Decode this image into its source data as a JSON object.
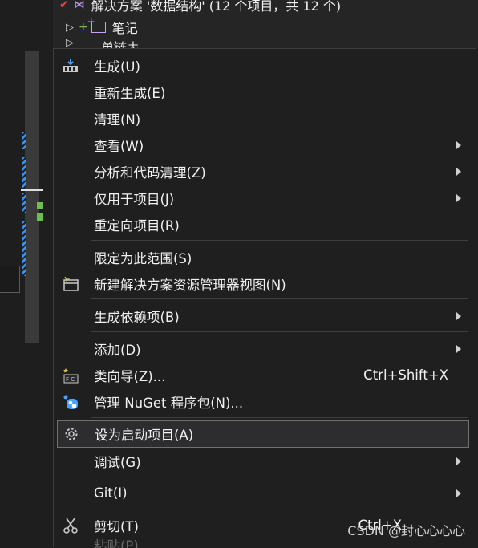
{
  "tree": {
    "solution_label": "解决方案 '数据结构' (12 个项目，共 12 个)",
    "notes_label": "笔记",
    "next_label": "单链表"
  },
  "menu": {
    "build": "生成(U)",
    "rebuild": "重新生成(E)",
    "clean": "清理(N)",
    "view": "查看(W)",
    "analyze": "分析和代码清理(Z)",
    "project_only": "仅用于项目(J)",
    "retarget": "重定向项目(R)",
    "scope": "限定为此范围(S)",
    "new_view": "新建解决方案资源管理器视图(N)",
    "dependencies": "生成依赖项(B)",
    "add": "添加(D)",
    "class_wizard": "类向导(Z)...",
    "class_wizard_shortcut": "Ctrl+Shift+X",
    "nuget": "管理 NuGet 程序包(N)...",
    "startup": "设为启动项目(A)",
    "debug": "调试(G)",
    "git": "Git(I)",
    "cut": "剪切(T)",
    "cut_shortcut": "Ctrl+X",
    "paste": "粘贴(P)"
  },
  "watermark": "CSDN @封心心心心"
}
